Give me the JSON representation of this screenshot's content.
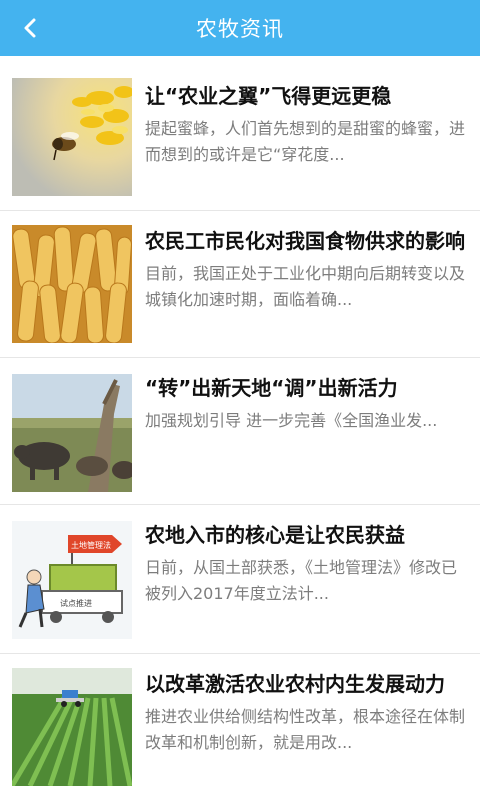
{
  "header": {
    "title": "农牧资讯",
    "back_icon": "chevron-left-icon"
  },
  "theme": {
    "accent": "#44b3ef",
    "title_color": "#111111",
    "desc_color": "#7d7d7d"
  },
  "articles": [
    {
      "title": "让“农业之翼”飞得更远更稳",
      "desc": "提起蜜蜂，人们首先想到的是甜蜜的蜂蜜，进而想到的或许是它“穿花度...",
      "thumb": "bee-on-flower-image"
    },
    {
      "title": "农民工市民化对我国食物供求的影响",
      "desc": "目前，我国正处于工业化中期向后期转变以及城镇化加速时期，面临着确...",
      "thumb": "corn-cobs-image"
    },
    {
      "title": "“转”出新天地“调”出新活力",
      "desc": "加强规划引导 进一步完善《全国渔业发...",
      "thumb": "grazing-cattle-image"
    },
    {
      "title": "农地入市的核心是让农民获益",
      "desc": "日前，从国土部获悉，《土地管理法》修改已被列入2017年度立法计...",
      "thumb": "farmer-cartoon-image",
      "cartoon_sign": "土地管理法",
      "cartoon_caption": "试点推进"
    },
    {
      "title": "以改革激活农业农村内生发展动力",
      "desc": "推进农业供给侧结构性改革，根本途径在体制改革和机制创新，就是用改...",
      "thumb": "crop-field-tractor-image"
    }
  ]
}
